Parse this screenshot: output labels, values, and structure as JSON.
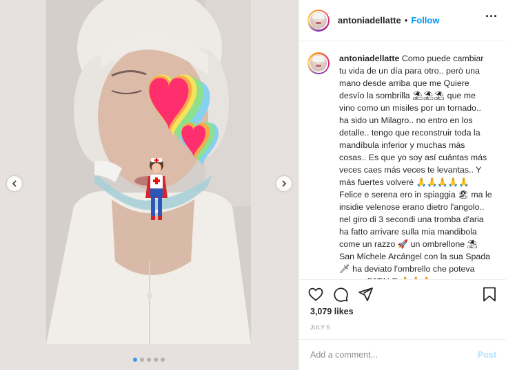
{
  "colors": {
    "accent": "#0095f6",
    "accent_disabled": "#b2dffc",
    "text": "#262626",
    "muted": "#8e8e8e"
  },
  "carousel": {
    "dot_count": 5,
    "active_index": 0
  },
  "header": {
    "username": "antoniadellatte",
    "separator": "•",
    "follow_label": "Follow"
  },
  "caption": {
    "username": "antoniadellatte",
    "text": "Como puede cambiar tu vida de un día para otro.. però una mano desde arriba que me Quiere desvío la sombrilla ⛱⛱⛱ que me vino como un misiles por un tornado.. ha sido un Milagro.. no entro en los detalle.. tengo que reconstruir toda la mandíbula inferior y muchas más cosas.. Es que yo soy así cuántas más veces caes más veces te levantas.. Y más fuertes volveré 🙏🙏🙏🙏🙏 Felice e serena ero in spiaggia 🏖 ma le insidie velenose erano dietro l'angolo.. nel giro di 3 secondi una tromba d'aria ha fatto arrivare sulla mia mandibola come un razzo 🚀 un ombrellone ⛱ San Michele Arcángel con la sua Spada 🗡 ha deviato l'ombrello che poteva essere FATALE 🙏🙏🙏"
  },
  "engagement": {
    "likes": "3,079 likes",
    "date": "JULY 5"
  },
  "comment": {
    "placeholder": "Add a comment...",
    "post_label": "Post"
  },
  "icons": {
    "like": "heart-icon",
    "comment": "comment-bubble-icon",
    "share": "paper-plane-icon",
    "save": "bookmark-icon",
    "more": "more-options-icon",
    "prev": "chevron-left-icon",
    "next": "chevron-right-icon"
  }
}
